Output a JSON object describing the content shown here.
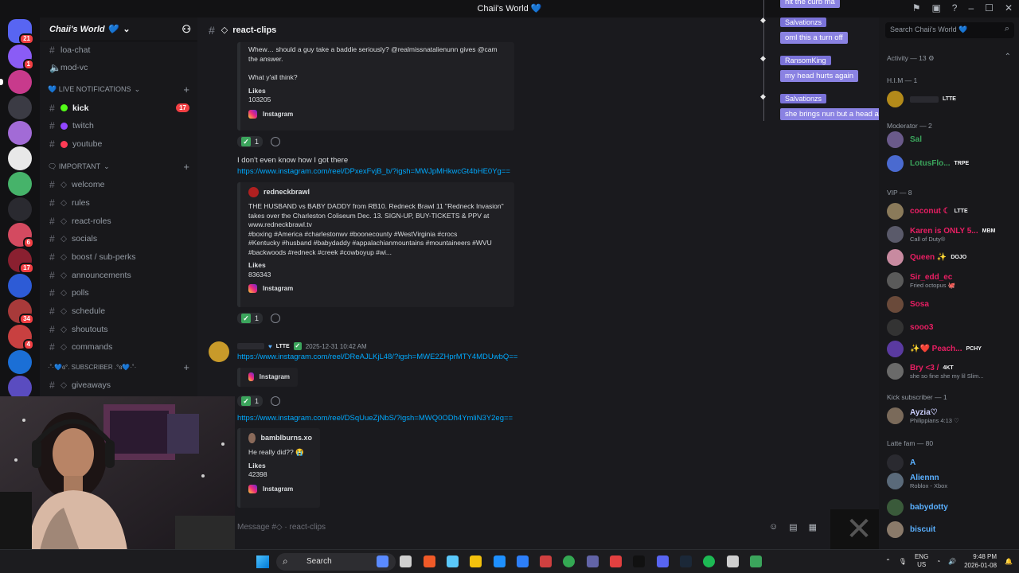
{
  "window": {
    "title": "Chaii's World 💙"
  },
  "servers": {
    "items": [
      {
        "name": "direct-messages",
        "color": "#5865f2",
        "badge": "21"
      },
      {
        "name": "server-1",
        "color": "#8a5cf5",
        "badge": "1"
      },
      {
        "name": "server-2",
        "color": "#c83a8c",
        "badge": "",
        "active": true
      },
      {
        "name": "server-3",
        "color": "#3b3b44",
        "badge": ""
      },
      {
        "name": "server-4",
        "color": "#a26bd6",
        "badge": ""
      },
      {
        "name": "server-5",
        "color": "#e8e8e8",
        "badge": ""
      },
      {
        "name": "server-6",
        "color": "#46b36a",
        "badge": ""
      },
      {
        "name": "server-7",
        "color": "#2a2a30",
        "badge": ""
      },
      {
        "name": "server-8",
        "color": "#d44a60",
        "badge": "6"
      },
      {
        "name": "server-9",
        "color": "#8a2030",
        "badge": "17"
      },
      {
        "name": "server-10",
        "color": "#2d5bd6",
        "badge": ""
      },
      {
        "name": "server-11",
        "color": "#a83a3a",
        "badge": "34"
      },
      {
        "name": "server-12",
        "color": "#c84040",
        "badge": "4"
      },
      {
        "name": "server-13",
        "color": "#1b6fd6",
        "badge": ""
      },
      {
        "name": "server-14",
        "color": "#5a4cc0",
        "badge": ""
      }
    ]
  },
  "guild": {
    "name": "Chaii's World 💙"
  },
  "channels": {
    "top": [
      {
        "label": "loa-chat"
      },
      {
        "label": "mod-vc"
      }
    ],
    "cat_live": "💙 LIVE NOTIFICATIONS",
    "live": [
      {
        "label": "kick",
        "dot": "#53fc18",
        "badge": "17"
      },
      {
        "label": "twitch",
        "dot": "#9146ff"
      },
      {
        "label": "youtube",
        "dot": "#ff3b55"
      }
    ],
    "cat_important": "🗨 IMPORTANT",
    "important": [
      {
        "label": "welcome"
      },
      {
        "label": "rules"
      },
      {
        "label": "react-roles"
      },
      {
        "label": "socials"
      },
      {
        "label": "boost / sub-perks"
      },
      {
        "label": "announcements"
      },
      {
        "label": "polls"
      },
      {
        "label": "schedule"
      },
      {
        "label": "shoutouts"
      },
      {
        "label": "commands"
      }
    ],
    "cat_subscriber": "·˚·💙ɞ°. SUBSCRIBER .°ɞ💙·˚·",
    "subscriber": [
      {
        "label": "giveaways"
      }
    ]
  },
  "chat": {
    "channel": "react-clips",
    "intro_line1": "Whew… should a guy take a baddie seriously? @realmissnatalienunn gives @cam",
    "intro_line2": "the answer.",
    "intro_q": "What y'all think?",
    "likes_label": "Likes",
    "intro_likes": "103205",
    "platform": "Instagram",
    "react_count": "1",
    "msg2_text": "I don't even know how I got there",
    "msg2_link": "https://www.instagram.com/reel/DPxexFvjB_b/?igsh=MWJpMHkwcGt4bHE0Yg==",
    "embed2": {
      "author": "redneckbrawl",
      "lines": [
        "THE HUSBAND vs BABY DADDY from RB10. Redneck Brawl 11 \"Redneck Invasion\"",
        "takes over the Charleston Coliseum Dec. 13. SIGN-UP, BUY-TICKETS & PPV at",
        "www.redneckbrawl.tv",
        "#boxing #America #charlestonwv #boonecounty #WestVirginia #crocs",
        "#Kentucky #husband #babydaddy #appalachianmountains #mountaineers #WVU",
        "#backwoods #redneck #creek #cowboyup #wi..."
      ],
      "likes": "836343"
    },
    "msg3_timestamp": "2025-12-31 10:42 AM",
    "msg3_tag": "LTTE",
    "msg3_link": "https://www.instagram.com/reel/DReAJLKjL48/?igsh=MWE2ZHprMTY4MDUwbQ==",
    "msg4_link": "https://www.instagram.com/reel/DSqUueZjNbS/?igsh=MWQ0ODh4YmliN3Y2eg==",
    "embed4": {
      "author": "bamblburns.xo",
      "text": "He really did?? 😭",
      "likes": "42398"
    },
    "composer_placeholder": "Message #◇ · react-clips"
  },
  "overlay": {
    "messages": [
      {
        "text": "hit the curb ma"
      },
      {
        "name": "Salvationzs",
        "text": "oml this a turn off"
      },
      {
        "name": "RansomKing",
        "text": "my head hurts again"
      },
      {
        "name": "Salvationzs",
        "text": "she brings nun but a head ache"
      }
    ]
  },
  "members": {
    "search_placeholder": "Search Chaii's World 💙",
    "activity": "Activity — 13 ⚙",
    "groups": {
      "him": "H.I.M — 1",
      "mod": "Moderator — 2",
      "vip": "VIP — 8",
      "kick": "Kick subscriber — 1",
      "latte": "Latte fam — 80"
    },
    "him_tag": "LTTE",
    "list": [
      {
        "name": "Sal",
        "color": "#3ba55c",
        "tag": "",
        "sub": ""
      },
      {
        "name": "LotusFlo...",
        "color": "#3ba55c",
        "tag": "TRPE",
        "sub": ""
      },
      {
        "name": "coconut ☾",
        "color": "#e91e63",
        "tag": "LTTE",
        "sub": ""
      },
      {
        "name": "Karen is ONLY 5...",
        "color": "#e91e63",
        "tag": "MBM",
        "sub": "Call of Duty®"
      },
      {
        "name": "Queen ✨",
        "color": "#e91e63",
        "tag": "DOJO",
        "sub": ""
      },
      {
        "name": "Sir_edd_ec",
        "color": "#e91e63",
        "tag": "",
        "sub": "Fried octopus 🐙"
      },
      {
        "name": "Sosa",
        "color": "#e91e63",
        "tag": "",
        "sub": ""
      },
      {
        "name": "sooo3",
        "color": "#e91e63",
        "tag": "",
        "sub": ""
      },
      {
        "name": "✨❤️ Peach...",
        "color": "#e91e63",
        "tag": "PCHY",
        "sub": ""
      },
      {
        "name": "Bry <3 /",
        "color": "#e91e63",
        "tag": "4KT",
        "sub": "she so fine she my lil Slim..."
      },
      {
        "name": "Ayzia♡",
        "color": "#c9cdfb",
        "tag": "",
        "sub": "Philippians 4:13 ♡"
      },
      {
        "name": "A",
        "color": "#5ab0ff",
        "tag": "",
        "sub": ""
      },
      {
        "name": "Aliennn",
        "color": "#5ab0ff",
        "tag": "",
        "sub": "Roblox - Xbox"
      },
      {
        "name": "babydotty",
        "color": "#5ab0ff",
        "tag": "",
        "sub": ""
      },
      {
        "name": "biscuit",
        "color": "#5ab0ff",
        "tag": "",
        "sub": ""
      }
    ]
  },
  "taskbar": {
    "search": "Search",
    "lang1": "ENG",
    "lang2": "US",
    "time": "9:48 PM",
    "date": "2026-01-08"
  }
}
